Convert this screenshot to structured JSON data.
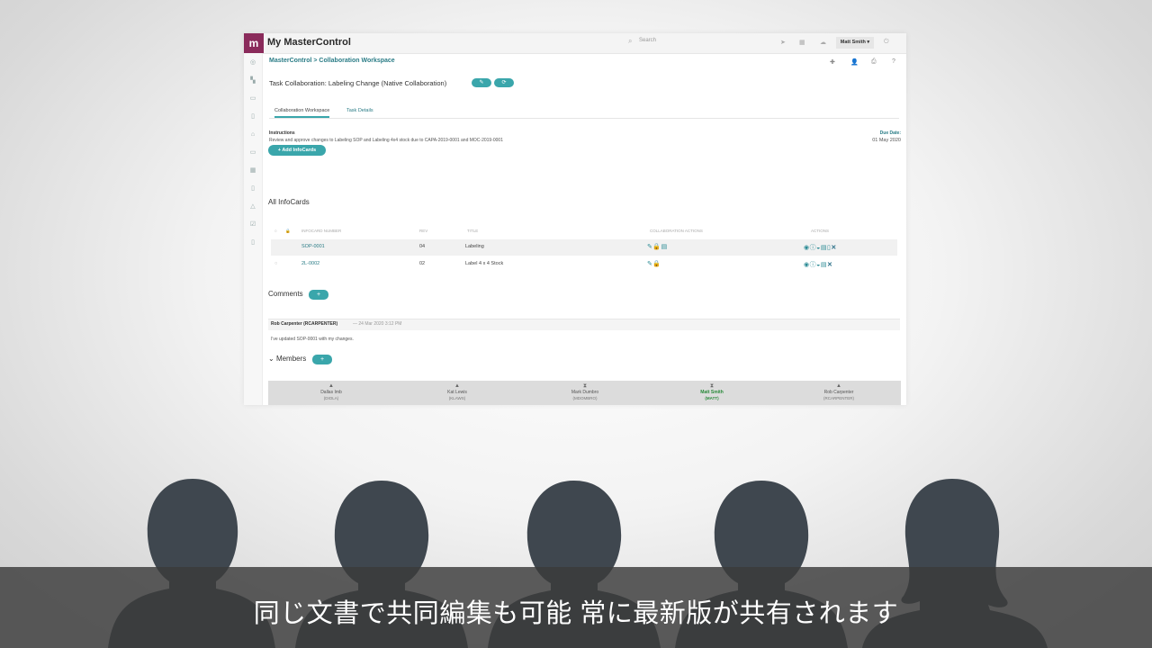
{
  "app": {
    "logo_text": "m",
    "title": "My MasterControl",
    "search_placeholder": "Search",
    "user_menu": "Matt Smith ▾"
  },
  "page": {
    "breadcrumb": "MasterControl > Collaboration Workspace",
    "task_title": "Task Collaboration: Labeling Change (Native Collaboration)",
    "tabs": [
      "Collaboration Workspace",
      "Task Details"
    ],
    "instructions_label": "Instructions",
    "instructions_text": "Review and approve changes to Labeling SOP and Labeling 4x4 stock due to CAPA-2019-0001 and MOC-2019-0001",
    "due_label": "Due Date:",
    "due_date": "01 May 2020",
    "add_infocards_label": "+ Add InfoCards"
  },
  "infocards": {
    "heading": "All InfoCards",
    "columns": [
      "INFOCARD NUMBER",
      "REV",
      "TITLE",
      "COLLABORATION ACTIONS",
      "ACTIONS"
    ],
    "rows": [
      {
        "number": "SOP-0001",
        "rev": "04",
        "title": "Labeling"
      },
      {
        "number": "2L-0002",
        "rev": "02",
        "title": "Label 4 x 4 Stock"
      }
    ]
  },
  "comments": {
    "heading": "Comments",
    "author": "Rob Carpenter (RCARPENTER)",
    "time": "— 24 Mar 2020 3:12 PM",
    "body": "I've updated SOP-0001 with my changes."
  },
  "members": {
    "heading": "Members",
    "list": [
      {
        "name": "Dallas Imb",
        "id": "(DIOLA)"
      },
      {
        "name": "Kat Lewis",
        "id": "(KLAWS)"
      },
      {
        "name": "Mark Dumbro",
        "id": "(MDOMBRO)"
      },
      {
        "name": "Matt Smith",
        "id": "(MATT)"
      },
      {
        "name": "Rob Carpenter",
        "id": "(RCARPENTER)"
      }
    ]
  },
  "caption": "同じ文書で共同編集も可能 常に最新版が共有されます",
  "colors": {
    "accent": "#3aa6ab",
    "link": "#2a7c86",
    "logo": "#8a2b5b",
    "silhouette": "#3f474f"
  }
}
